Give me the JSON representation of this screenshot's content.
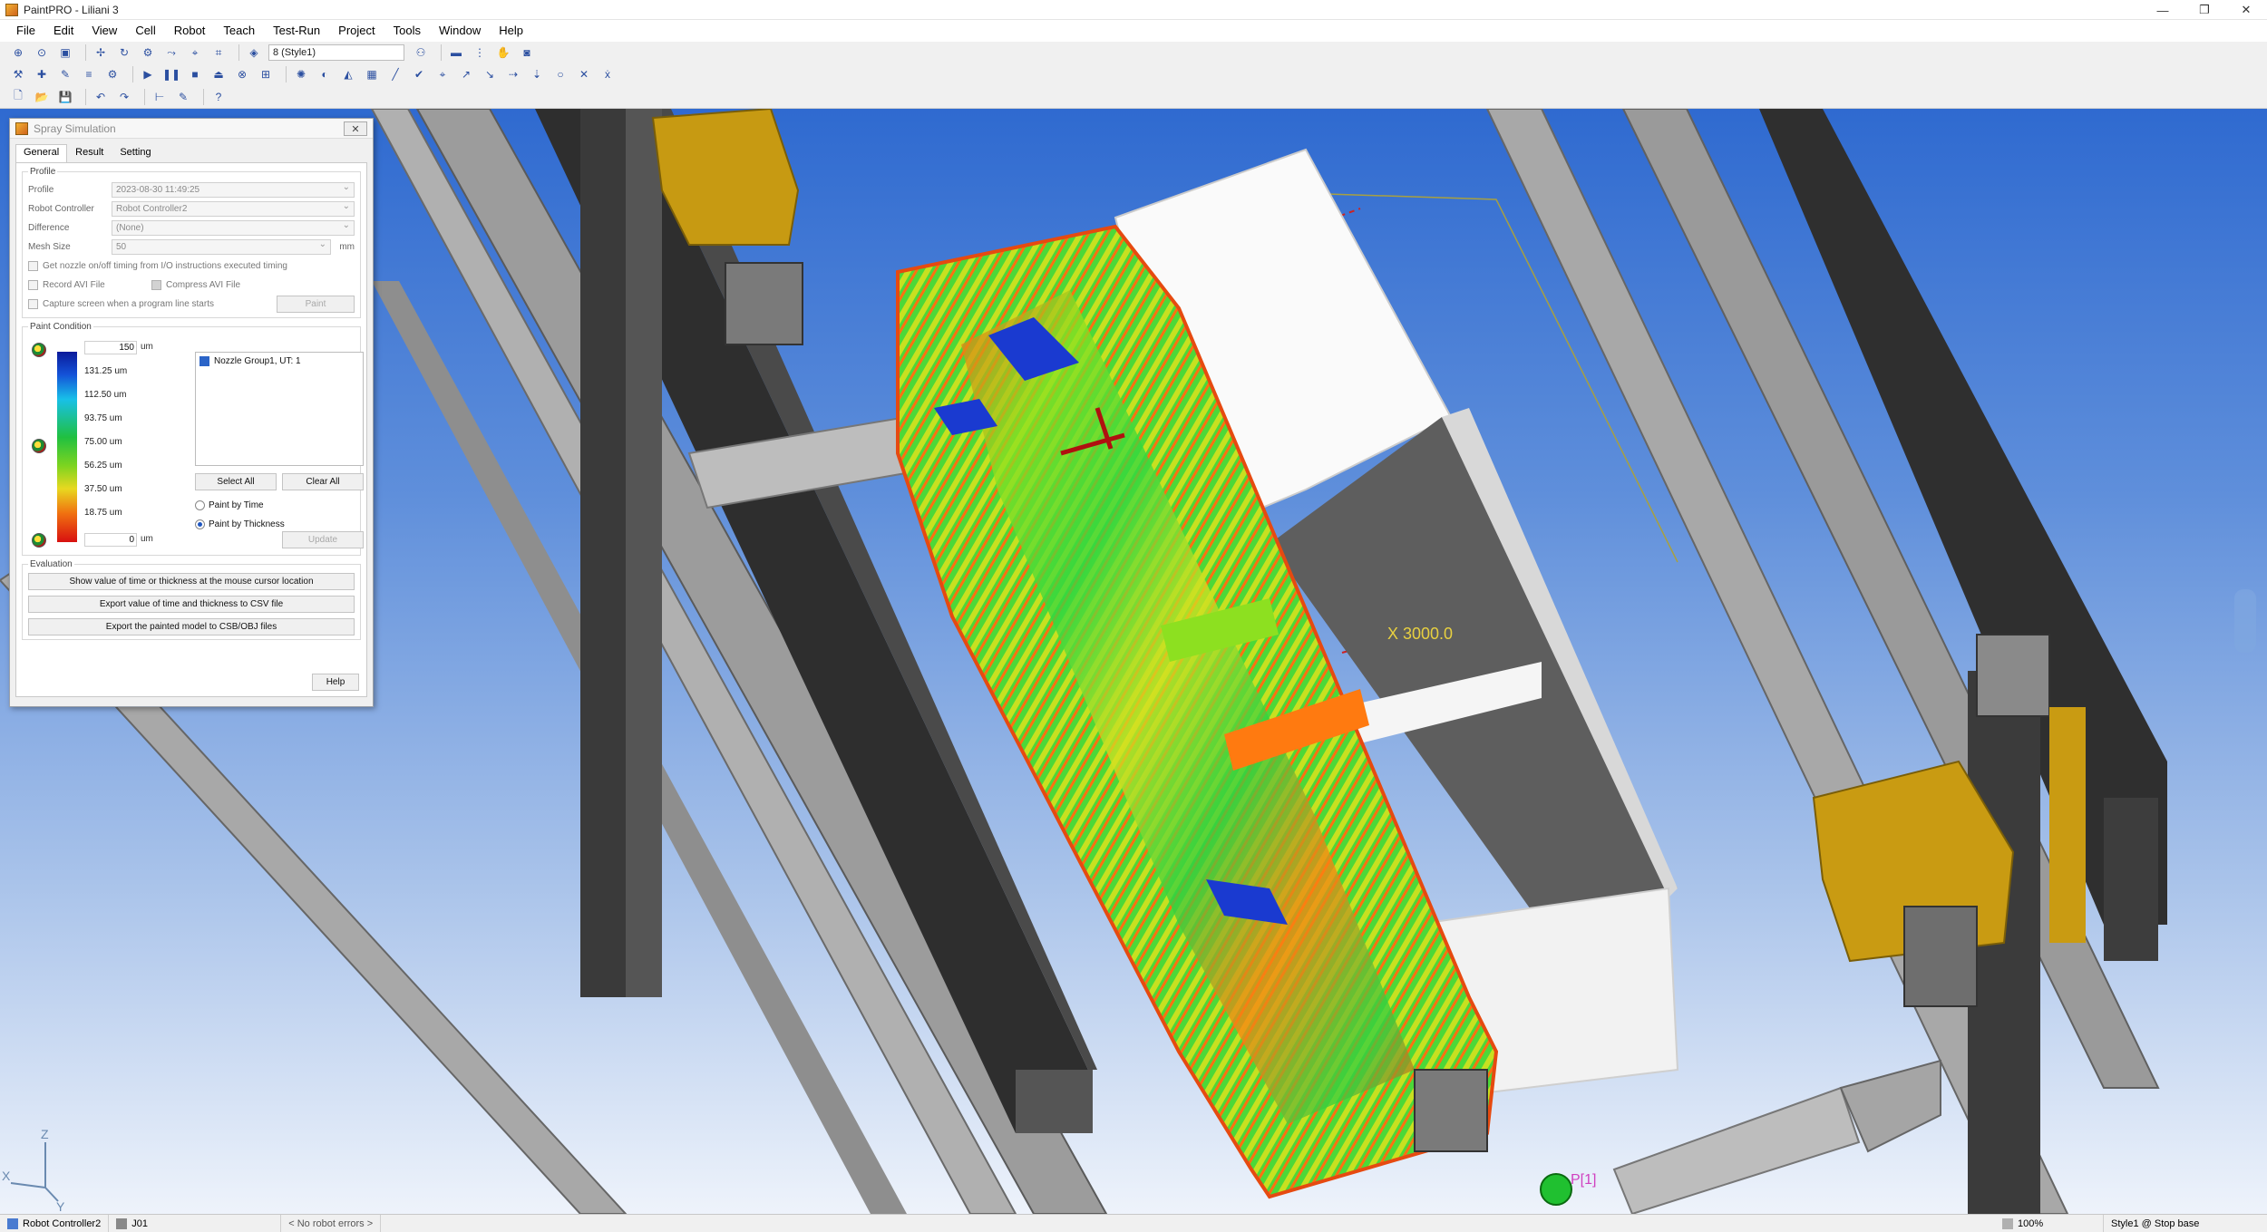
{
  "window": {
    "title": "PaintPRO - Liliani 3",
    "buttons": [
      "—",
      "❐",
      "✕"
    ]
  },
  "menu": [
    "File",
    "Edit",
    "View",
    "Cell",
    "Robot",
    "Teach",
    "Test-Run",
    "Project",
    "Tools",
    "Window",
    "Help"
  ],
  "toolbar": {
    "style_combo": "8 (Style1)"
  },
  "dialog": {
    "title": "Spray Simulation",
    "close": "✕",
    "tabs": [
      "General",
      "Result",
      "Setting"
    ],
    "profile_group": "Profile",
    "profile_label": "Profile",
    "profile_value": "2023-08-30 11:49:25",
    "controller_label": "Robot Controller",
    "controller_value": "Robot Controller2",
    "difference_label": "Difference",
    "difference_value": "(None)",
    "mesh_label": "Mesh Size",
    "mesh_value": "50",
    "mesh_unit": "mm",
    "opt_io": "Get nozzle on/off timing from I/O instructions executed timing",
    "opt_record": "Record AVI File",
    "opt_compress": "Compress AVI File",
    "opt_capture": "Capture screen when a program line starts",
    "paint_button": "Paint",
    "paint_condition_group": "Paint Condition",
    "max_value": "150",
    "min_value": "0",
    "unit": "um",
    "legend_labels": [
      "131.25 um",
      "112.50 um",
      "93.75 um",
      "75.00 um",
      "56.25 um",
      "37.50 um",
      "18.75 um"
    ],
    "nozzle_item": "Nozzle Group1, UT: 1",
    "select_all": "Select All",
    "clear_all": "Clear All",
    "paint_by_time": "Paint by Time",
    "paint_by_thickness": "Paint by Thickness",
    "update": "Update",
    "evaluation_group": "Evaluation",
    "eval_show": "Show value of time or thickness at the mouse cursor location",
    "eval_export_csv": "Export value of time and thickness to CSV file",
    "eval_export_model": "Export the painted model to CSB/OBJ files",
    "help": "Help"
  },
  "viewport": {
    "dimension_label": "X 3000.0",
    "robot_label": "P[1]",
    "axis_z": "Z",
    "axis_x": "X",
    "axis_y": "Y"
  },
  "status": {
    "controller": "Robot Controller2",
    "program": "J01",
    "errors": "< No robot errors >",
    "zoom": "100%",
    "style": "Style1 @ Stop base"
  },
  "colors": {
    "accent": "#2b64c8",
    "gold": "#c99b12",
    "rail_dark": "#3a3a3a",
    "rail_grey": "#9a9a9a"
  }
}
